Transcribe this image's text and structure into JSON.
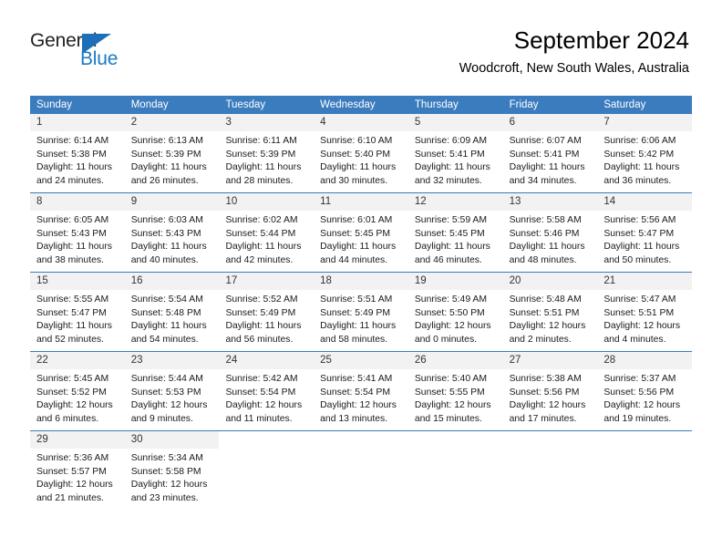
{
  "brand": {
    "name_part1": "General",
    "name_part2": "Blue",
    "logo_color": "#1d6fb8"
  },
  "header": {
    "month_title": "September 2024",
    "location": "Woodcroft, New South Wales, Australia"
  },
  "theme": {
    "header_blue": "#3b7cbf",
    "day_band_gray": "#f2f2f2",
    "text_color": "#1a1a1a"
  },
  "calendar": {
    "weekdays": [
      "Sunday",
      "Monday",
      "Tuesday",
      "Wednesday",
      "Thursday",
      "Friday",
      "Saturday"
    ],
    "weeks": [
      [
        {
          "day": "1",
          "sunrise": "Sunrise: 6:14 AM",
          "sunset": "Sunset: 5:38 PM",
          "daylight_line1": "Daylight: 11 hours",
          "daylight_line2": "and 24 minutes."
        },
        {
          "day": "2",
          "sunrise": "Sunrise: 6:13 AM",
          "sunset": "Sunset: 5:39 PM",
          "daylight_line1": "Daylight: 11 hours",
          "daylight_line2": "and 26 minutes."
        },
        {
          "day": "3",
          "sunrise": "Sunrise: 6:11 AM",
          "sunset": "Sunset: 5:39 PM",
          "daylight_line1": "Daylight: 11 hours",
          "daylight_line2": "and 28 minutes."
        },
        {
          "day": "4",
          "sunrise": "Sunrise: 6:10 AM",
          "sunset": "Sunset: 5:40 PM",
          "daylight_line1": "Daylight: 11 hours",
          "daylight_line2": "and 30 minutes."
        },
        {
          "day": "5",
          "sunrise": "Sunrise: 6:09 AM",
          "sunset": "Sunset: 5:41 PM",
          "daylight_line1": "Daylight: 11 hours",
          "daylight_line2": "and 32 minutes."
        },
        {
          "day": "6",
          "sunrise": "Sunrise: 6:07 AM",
          "sunset": "Sunset: 5:41 PM",
          "daylight_line1": "Daylight: 11 hours",
          "daylight_line2": "and 34 minutes."
        },
        {
          "day": "7",
          "sunrise": "Sunrise: 6:06 AM",
          "sunset": "Sunset: 5:42 PM",
          "daylight_line1": "Daylight: 11 hours",
          "daylight_line2": "and 36 minutes."
        }
      ],
      [
        {
          "day": "8",
          "sunrise": "Sunrise: 6:05 AM",
          "sunset": "Sunset: 5:43 PM",
          "daylight_line1": "Daylight: 11 hours",
          "daylight_line2": "and 38 minutes."
        },
        {
          "day": "9",
          "sunrise": "Sunrise: 6:03 AM",
          "sunset": "Sunset: 5:43 PM",
          "daylight_line1": "Daylight: 11 hours",
          "daylight_line2": "and 40 minutes."
        },
        {
          "day": "10",
          "sunrise": "Sunrise: 6:02 AM",
          "sunset": "Sunset: 5:44 PM",
          "daylight_line1": "Daylight: 11 hours",
          "daylight_line2": "and 42 minutes."
        },
        {
          "day": "11",
          "sunrise": "Sunrise: 6:01 AM",
          "sunset": "Sunset: 5:45 PM",
          "daylight_line1": "Daylight: 11 hours",
          "daylight_line2": "and 44 minutes."
        },
        {
          "day": "12",
          "sunrise": "Sunrise: 5:59 AM",
          "sunset": "Sunset: 5:45 PM",
          "daylight_line1": "Daylight: 11 hours",
          "daylight_line2": "and 46 minutes."
        },
        {
          "day": "13",
          "sunrise": "Sunrise: 5:58 AM",
          "sunset": "Sunset: 5:46 PM",
          "daylight_line1": "Daylight: 11 hours",
          "daylight_line2": "and 48 minutes."
        },
        {
          "day": "14",
          "sunrise": "Sunrise: 5:56 AM",
          "sunset": "Sunset: 5:47 PM",
          "daylight_line1": "Daylight: 11 hours",
          "daylight_line2": "and 50 minutes."
        }
      ],
      [
        {
          "day": "15",
          "sunrise": "Sunrise: 5:55 AM",
          "sunset": "Sunset: 5:47 PM",
          "daylight_line1": "Daylight: 11 hours",
          "daylight_line2": "and 52 minutes."
        },
        {
          "day": "16",
          "sunrise": "Sunrise: 5:54 AM",
          "sunset": "Sunset: 5:48 PM",
          "daylight_line1": "Daylight: 11 hours",
          "daylight_line2": "and 54 minutes."
        },
        {
          "day": "17",
          "sunrise": "Sunrise: 5:52 AM",
          "sunset": "Sunset: 5:49 PM",
          "daylight_line1": "Daylight: 11 hours",
          "daylight_line2": "and 56 minutes."
        },
        {
          "day": "18",
          "sunrise": "Sunrise: 5:51 AM",
          "sunset": "Sunset: 5:49 PM",
          "daylight_line1": "Daylight: 11 hours",
          "daylight_line2": "and 58 minutes."
        },
        {
          "day": "19",
          "sunrise": "Sunrise: 5:49 AM",
          "sunset": "Sunset: 5:50 PM",
          "daylight_line1": "Daylight: 12 hours",
          "daylight_line2": "and 0 minutes."
        },
        {
          "day": "20",
          "sunrise": "Sunrise: 5:48 AM",
          "sunset": "Sunset: 5:51 PM",
          "daylight_line1": "Daylight: 12 hours",
          "daylight_line2": "and 2 minutes."
        },
        {
          "day": "21",
          "sunrise": "Sunrise: 5:47 AM",
          "sunset": "Sunset: 5:51 PM",
          "daylight_line1": "Daylight: 12 hours",
          "daylight_line2": "and 4 minutes."
        }
      ],
      [
        {
          "day": "22",
          "sunrise": "Sunrise: 5:45 AM",
          "sunset": "Sunset: 5:52 PM",
          "daylight_line1": "Daylight: 12 hours",
          "daylight_line2": "and 6 minutes."
        },
        {
          "day": "23",
          "sunrise": "Sunrise: 5:44 AM",
          "sunset": "Sunset: 5:53 PM",
          "daylight_line1": "Daylight: 12 hours",
          "daylight_line2": "and 9 minutes."
        },
        {
          "day": "24",
          "sunrise": "Sunrise: 5:42 AM",
          "sunset": "Sunset: 5:54 PM",
          "daylight_line1": "Daylight: 12 hours",
          "daylight_line2": "and 11 minutes."
        },
        {
          "day": "25",
          "sunrise": "Sunrise: 5:41 AM",
          "sunset": "Sunset: 5:54 PM",
          "daylight_line1": "Daylight: 12 hours",
          "daylight_line2": "and 13 minutes."
        },
        {
          "day": "26",
          "sunrise": "Sunrise: 5:40 AM",
          "sunset": "Sunset: 5:55 PM",
          "daylight_line1": "Daylight: 12 hours",
          "daylight_line2": "and 15 minutes."
        },
        {
          "day": "27",
          "sunrise": "Sunrise: 5:38 AM",
          "sunset": "Sunset: 5:56 PM",
          "daylight_line1": "Daylight: 12 hours",
          "daylight_line2": "and 17 minutes."
        },
        {
          "day": "28",
          "sunrise": "Sunrise: 5:37 AM",
          "sunset": "Sunset: 5:56 PM",
          "daylight_line1": "Daylight: 12 hours",
          "daylight_line2": "and 19 minutes."
        }
      ],
      [
        {
          "day": "29",
          "sunrise": "Sunrise: 5:36 AM",
          "sunset": "Sunset: 5:57 PM",
          "daylight_line1": "Daylight: 12 hours",
          "daylight_line2": "and 21 minutes."
        },
        {
          "day": "30",
          "sunrise": "Sunrise: 5:34 AM",
          "sunset": "Sunset: 5:58 PM",
          "daylight_line1": "Daylight: 12 hours",
          "daylight_line2": "and 23 minutes."
        },
        {
          "day": "",
          "sunrise": "",
          "sunset": "",
          "daylight_line1": "",
          "daylight_line2": ""
        },
        {
          "day": "",
          "sunrise": "",
          "sunset": "",
          "daylight_line1": "",
          "daylight_line2": ""
        },
        {
          "day": "",
          "sunrise": "",
          "sunset": "",
          "daylight_line1": "",
          "daylight_line2": ""
        },
        {
          "day": "",
          "sunrise": "",
          "sunset": "",
          "daylight_line1": "",
          "daylight_line2": ""
        },
        {
          "day": "",
          "sunrise": "",
          "sunset": "",
          "daylight_line1": "",
          "daylight_line2": ""
        }
      ]
    ]
  }
}
